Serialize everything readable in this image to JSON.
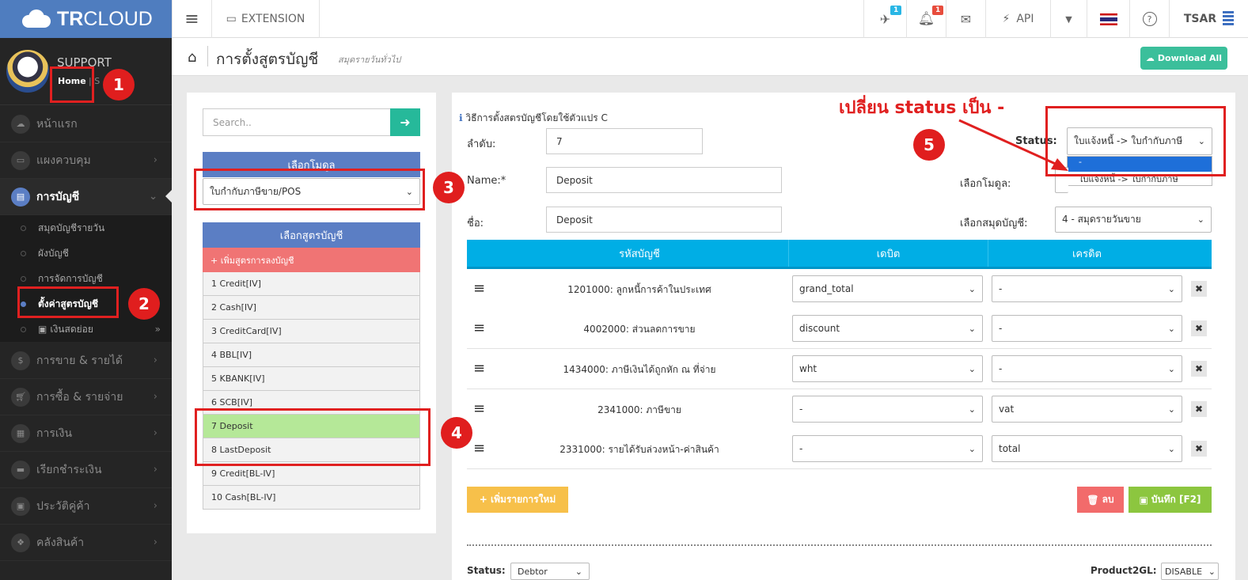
{
  "app": {
    "brand_bold": "TR",
    "brand_rest": "CLOUD"
  },
  "topbar": {
    "extension": "EXTENSION",
    "notif_a": "1",
    "notif_b": "1",
    "api": "API",
    "user": "TSAR"
  },
  "profile": {
    "name": "SUPPORT",
    "home": "Home",
    "home_sep": "| S"
  },
  "sidebar": {
    "items": [
      {
        "label": "หน้าแรก",
        "icon": "cloud-icon"
      },
      {
        "label": "แผงควบคุม",
        "icon": "monitor-icon"
      },
      {
        "label": "การบัญชี",
        "icon": "book-icon"
      },
      {
        "label": "การขาย & รายได้",
        "icon": "dollar-icon"
      },
      {
        "label": "การซื้อ & รายจ่าย",
        "icon": "cart-icon"
      },
      {
        "label": "การเงิน",
        "icon": "calendar-icon"
      },
      {
        "label": "เรียกชำระเงิน",
        "icon": "card-icon"
      },
      {
        "label": "ประวัติคู่ค้า",
        "icon": "contact-icon"
      },
      {
        "label": "คลังสินค้า",
        "icon": "cubes-icon"
      }
    ],
    "sub": [
      "สมุดบัญชีรายวัน",
      "ผังบัญชี",
      "การจัดการบัญชี",
      "ตั้งค่าสูตรบัญชี",
      "เงินสดย่อย"
    ]
  },
  "page": {
    "title": "การตั้งสูตรบัญชี",
    "subtitle": "สมุดรายวันทั่วไป",
    "download": "Download All"
  },
  "left": {
    "search_placeholder": "Search..",
    "module_header": "เลือกโมดูล",
    "module_value": "ใบกำกับภาษีขาย/POS",
    "formula_header": "เลือกสูตรบัญชี",
    "add_formula": "+ เพิ่มสูตรการลงบัญชี",
    "formulas": [
      "1 Credit[IV]",
      "2 Cash[IV]",
      "3 CreditCard[IV]",
      "4 BBL[IV]",
      "5 KBANK[IV]",
      "6 SCB[IV]",
      "7 Deposit",
      "8 LastDeposit",
      "9 Credit[BL-IV]",
      "10 Cash[BL-IV]"
    ]
  },
  "form": {
    "info": "วิธีการตั้งสตรบัญชีโดยใช้ตัวแปร C",
    "order_label": "ลำดับ:",
    "order_value": "7",
    "name_label": "Name:*",
    "name_value": "Deposit",
    "thname_label": "ชื่อ:",
    "thname_value": "Deposit",
    "status_label": "Status:",
    "status_value": "ใบแจ้งหนี้ -> ใบกำกับภาษี",
    "status_options": [
      "-",
      "ใบแจ้งหนี้ -> ใบกำกับภาษี"
    ],
    "module_label": "เลือกโมดูล:",
    "journal_label": "เลือกสมุดบัญชี:",
    "journal_value": "4 - สมุดรายวันขาย"
  },
  "table": {
    "headers": [
      "รหัสบัญชี",
      "เดบิต",
      "เครดิต"
    ],
    "rows": [
      {
        "account": "1201000: ลูกหนี้การค้าในประเทศ",
        "debit": "grand_total",
        "credit": "-"
      },
      {
        "account": "4002000: ส่วนลดการขาย",
        "debit": "discount",
        "credit": "-"
      },
      {
        "account": "1434000: ภาษีเงินได้ถูกหัก ณ ที่จ่าย",
        "debit": "wht",
        "credit": "-"
      },
      {
        "account": "2341000: ภาษีขาย",
        "debit": "-",
        "credit": "vat"
      },
      {
        "account": "2331000: รายได้รับล่วงหน้า-ค่าสินค้า",
        "debit": "-",
        "credit": "total"
      }
    ]
  },
  "buttons": {
    "add_row": "+ เพิ่มรายการใหม่",
    "delete": "ลบ",
    "save": "บันทึก [F2]"
  },
  "footer": {
    "status_label": "Status:",
    "status_value": "Debtor",
    "p2gl_label": "Product2GL:",
    "p2gl_value": "DISABLE"
  },
  "annotations": {
    "n1": "1",
    "n2": "2",
    "n3": "3",
    "n4": "4",
    "n5": "5",
    "note": "เปลี่ยน status เป็น -"
  },
  "colors": {
    "accent": "#4f7dbf",
    "table_head": "#00aee5",
    "red": "#e02020",
    "green": "#8cc63f",
    "danger": "#f26b6b",
    "warning": "#f7c04a"
  }
}
